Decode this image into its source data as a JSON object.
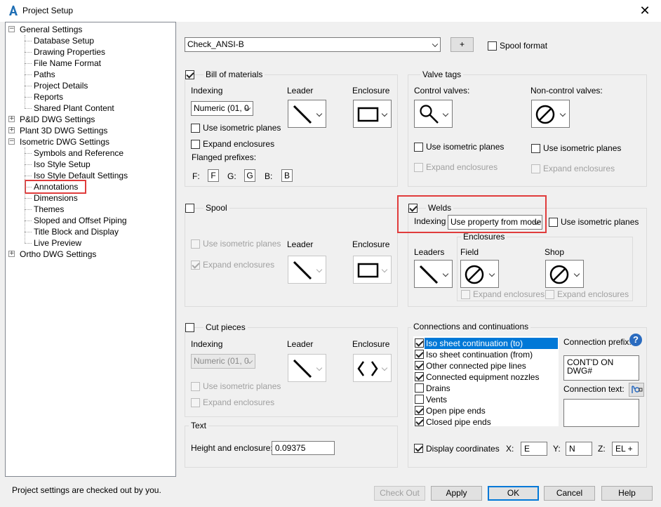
{
  "window": {
    "title": "Project Setup",
    "close_glyph": "✕",
    "icon": "autocad-a-icon"
  },
  "tree": {
    "items": [
      {
        "label": "General Settings",
        "expander": "−"
      },
      {
        "label": "Database Setup"
      },
      {
        "label": "Drawing Properties"
      },
      {
        "label": "File Name Format"
      },
      {
        "label": "Paths"
      },
      {
        "label": "Project Details"
      },
      {
        "label": "Reports"
      },
      {
        "label": "Shared Plant Content"
      },
      {
        "label": "P&ID DWG Settings",
        "expander": "+"
      },
      {
        "label": "Plant 3D DWG Settings",
        "expander": "+"
      },
      {
        "label": "Isometric DWG Settings",
        "expander": "−"
      },
      {
        "label": "Symbols and Reference"
      },
      {
        "label": "Iso Style Setup"
      },
      {
        "label": "Iso Style Default Settings"
      },
      {
        "label": "Annotations",
        "highlighted": true
      },
      {
        "label": "Dimensions"
      },
      {
        "label": "Themes"
      },
      {
        "label": "Sloped and Offset Piping"
      },
      {
        "label": "Title Block and Display"
      },
      {
        "label": "Live Preview"
      },
      {
        "label": "Ortho DWG Settings",
        "expander": "+"
      }
    ]
  },
  "top": {
    "style_value": "Check_ANSI-B",
    "add_label": "+",
    "spool_format_label": "Spool format",
    "spool_format_checked": false
  },
  "bom": {
    "title": "Bill of materials",
    "checked": true,
    "indexing_label": "Indexing",
    "indexing_value": "Numeric (01, 0",
    "leader_label": "Leader",
    "enclosure_label": "Enclosure",
    "use_iso_label": "Use isometric planes",
    "expand_label": "Expand enclosures",
    "flanged_label": "Flanged prefixes:",
    "f_label": "F:",
    "f_value": "F",
    "g_label": "G:",
    "g_value": "G",
    "b_label": "B:",
    "b_value": "B"
  },
  "valve": {
    "title": "Valve tags",
    "control_label": "Control valves:",
    "noncontrol_label": "Non-control valves:",
    "use_iso_label": "Use isometric planes",
    "expand_label": "Expand enclosures",
    "use_iso_label2": "Use isometric planes",
    "expand_label2": "Expand enclosures"
  },
  "spool": {
    "title": "Spool",
    "checked": false,
    "use_iso_label": "Use isometric planes",
    "expand_label": "Expand enclosures",
    "leader_label": "Leader",
    "enclosure_label": "Enclosure"
  },
  "welds": {
    "title": "Welds",
    "checked": true,
    "indexing_label": "Indexing",
    "indexing_value": "Use property from mode",
    "use_iso_label": "Use isometric planes",
    "enclosures_label": "Enclosures",
    "leaders_label": "Leaders",
    "field_label": "Field",
    "shop_label": "Shop",
    "expand_label": "Expand enclosures",
    "expand_label2": "Expand enclosures"
  },
  "cut": {
    "title": "Cut pieces",
    "checked": false,
    "indexing_label": "Indexing",
    "indexing_value": "Numeric (01, 0",
    "leader_label": "Leader",
    "enclosure_label": "Enclosure",
    "use_iso_label": "Use isometric planes",
    "expand_label": "Expand enclosures"
  },
  "text_group": {
    "title": "Text",
    "height_label": "Height and enclosure:",
    "height_value": "0.09375"
  },
  "connections": {
    "title": "Connections and continuations",
    "items": [
      {
        "label": "Iso sheet continuation (to)",
        "checked": true,
        "selected": true
      },
      {
        "label": "Iso sheet continuation (from)",
        "checked": true
      },
      {
        "label": "Other connected pipe lines",
        "checked": true
      },
      {
        "label": "Connected equipment nozzles",
        "checked": true
      },
      {
        "label": "Drains",
        "checked": false
      },
      {
        "label": "Vents",
        "checked": false
      },
      {
        "label": "Open pipe ends",
        "checked": true
      },
      {
        "label": "Closed pipe ends",
        "checked": true
      }
    ],
    "prefix_label": "Connection prefix:",
    "prefix_value_line1": "CONT'D ON",
    "prefix_value_line2": "DWG#",
    "text_label": "Connection text:",
    "help_glyph": "?",
    "display_coords_label": "Display coordinates",
    "display_coords_checked": true,
    "x_label": "X:",
    "x_value": "E",
    "y_label": "Y:",
    "y_value": "N",
    "z_label": "Z:",
    "z_value": "EL +"
  },
  "footer": {
    "status": "Project settings are checked out by you.",
    "checkout_label": "Check Out",
    "apply_label": "Apply",
    "ok_label": "OK",
    "cancel_label": "Cancel",
    "help_label": "Help"
  }
}
